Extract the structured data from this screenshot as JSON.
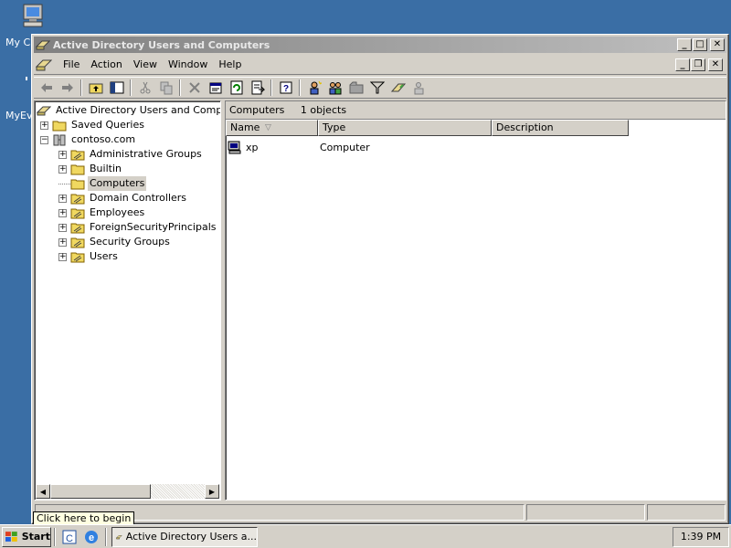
{
  "desktop": {
    "icons": [
      {
        "label": "My C",
        "icon": "my-computer-icon"
      },
      {
        "label": "MyEv",
        "icon": "shortcut-icon"
      }
    ]
  },
  "window": {
    "title": "Active Directory Users and Computers",
    "caption_buttons": [
      "minimize",
      "maximize",
      "close"
    ]
  },
  "menubar": {
    "items": [
      "File",
      "Action",
      "View",
      "Window",
      "Help"
    ]
  },
  "toolbar": {
    "buttons": [
      "back",
      "forward",
      "up-one-level",
      "show-hide-console-tree",
      "cut",
      "copy",
      "delete",
      "properties",
      "refresh",
      "export-list",
      "help",
      "create-user",
      "create-group",
      "create-ou",
      "filter",
      "find",
      "add-to-group"
    ]
  },
  "tree": {
    "root_label": "Active Directory Users and Computers",
    "saved_queries": "Saved Queries",
    "domain": "contoso.com",
    "children": [
      {
        "label": "Administrative Groups",
        "expandable": true,
        "selected": false
      },
      {
        "label": "Builtin",
        "expandable": true,
        "selected": false
      },
      {
        "label": "Computers",
        "expandable": false,
        "selected": true
      },
      {
        "label": "Domain Controllers",
        "expandable": true,
        "selected": false
      },
      {
        "label": "Employees",
        "expandable": true,
        "selected": false
      },
      {
        "label": "ForeignSecurityPrincipals",
        "expandable": true,
        "selected": false
      },
      {
        "label": "Security Groups",
        "expandable": true,
        "selected": false
      },
      {
        "label": "Users",
        "expandable": true,
        "selected": false
      }
    ]
  },
  "list": {
    "container": "Computers",
    "count_text": "1 objects",
    "columns": [
      "Name",
      "Type",
      "Description"
    ],
    "rows": [
      {
        "name": "xp",
        "type": "Computer",
        "description": ""
      }
    ]
  },
  "tooltip": "Click here to begin",
  "taskbar": {
    "start_label": "Start",
    "task_label": "Active Directory Users a...",
    "clock": "1:39 PM"
  }
}
